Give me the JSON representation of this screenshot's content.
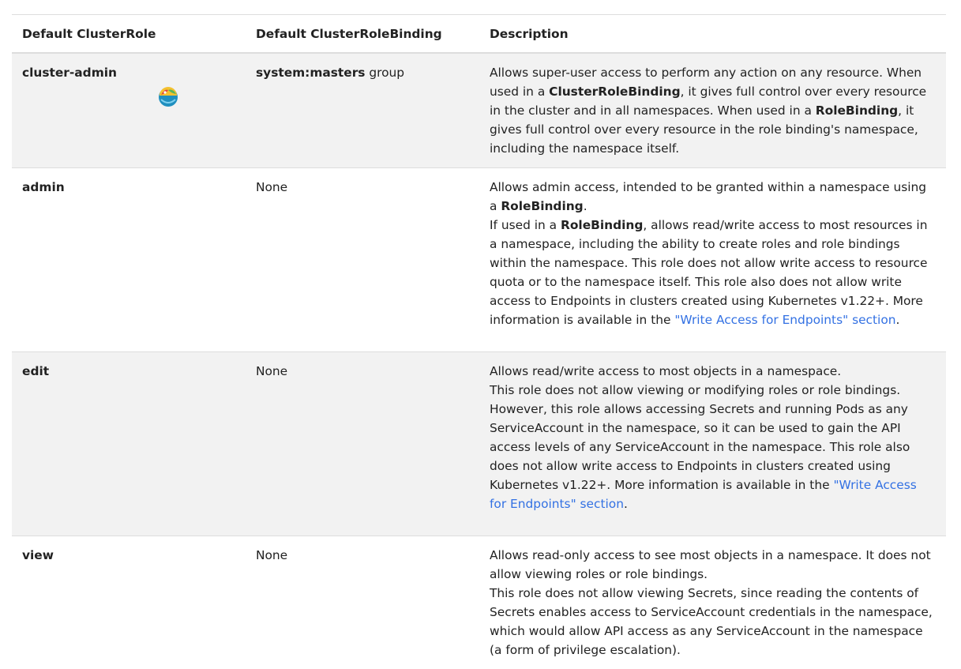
{
  "header": {
    "col1": "Default ClusterRole",
    "col2": "Default ClusterRoleBinding",
    "col3": "Description"
  },
  "rows": [
    {
      "role": "cluster-admin",
      "binding_bold": "system:masters",
      "binding_rest": " group",
      "desc": {
        "t1": "Allows super-user access to perform any action on any resource. When used in a ",
        "b1": "ClusterRoleBinding",
        "t2": ", it gives full control over every resource in the cluster and in all namespaces. When used in a ",
        "b2": "RoleBinding",
        "t3": ", it gives full control over every resource in the role binding's namespace, including the namespace itself."
      }
    },
    {
      "role": "admin",
      "binding": "None",
      "desc": {
        "t1": "Allows admin access, intended to be granted within a namespace using a ",
        "b1": "RoleBinding",
        "t2": ".",
        "t3": "If used in a ",
        "b2": "RoleBinding",
        "t4": ", allows read/write access to most resources in a namespace, including the ability to create roles and role bindings within the namespace. This role does not allow write access to resource quota or to the namespace itself. This role also does not allow write access to Endpoints in clusters created using Kubernetes v1.22+. More information is available in the ",
        "link": "\"Write Access for Endpoints\" section",
        "t5": "."
      }
    },
    {
      "role": "edit",
      "binding": "None",
      "desc": {
        "t1": "Allows read/write access to most objects in a namespace.",
        "t2": "This role does not allow viewing or modifying roles or role bindings. However, this role allows accessing Secrets and running Pods as any ServiceAccount in the namespace, so it can be used to gain the API access levels of any ServiceAccount in the namespace. This role also does not allow write access to Endpoints in clusters created using Kubernetes v1.22+. More information is available in the ",
        "link": "\"Write Access for Endpoints\" section",
        "t3": "."
      }
    },
    {
      "role": "view",
      "binding": "None",
      "desc": {
        "t1": "Allows read-only access to see most objects in a namespace. It does not allow viewing roles or role bindings.",
        "t2": "This role does not allow viewing Secrets, since reading the contents of Secrets enables access to ServiceAccount credentials in the namespace, which would allow API access as any ServiceAccount in the namespace (a form of privilege escalation)."
      }
    }
  ],
  "badge_icon": "colorful-bowl-icon",
  "colors": {
    "link": "#3371e3",
    "row_shade": "#f2f2f2",
    "border": "#dddddd",
    "text": "#222222"
  }
}
